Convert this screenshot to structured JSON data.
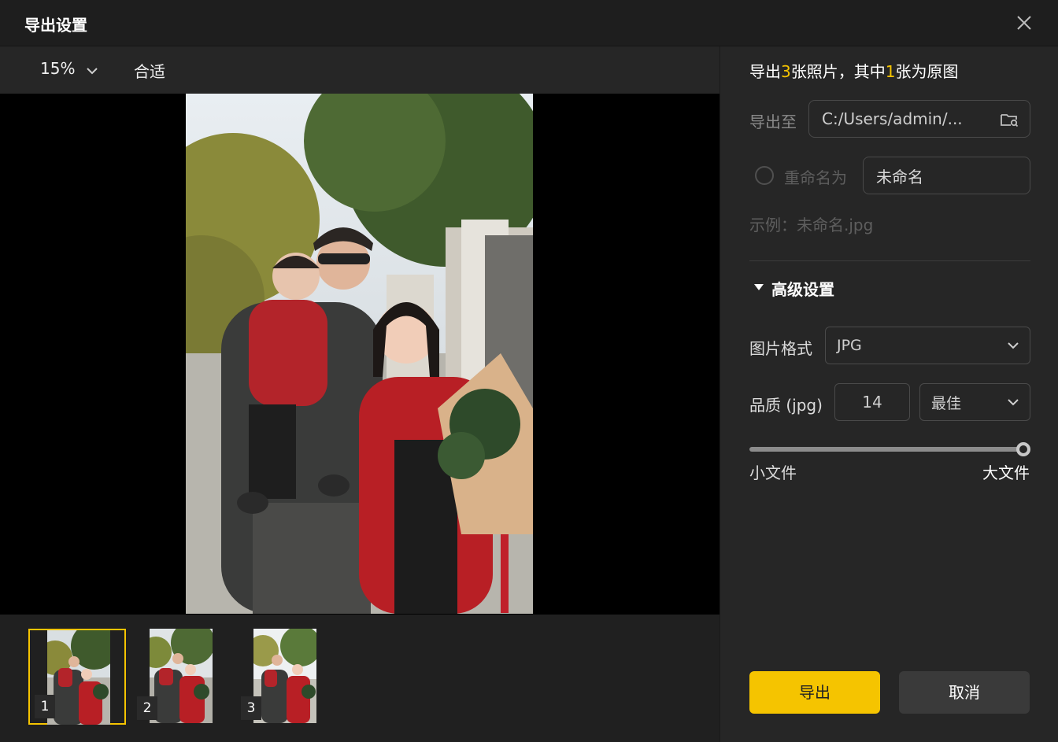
{
  "window": {
    "title": "导出设置"
  },
  "toolbar": {
    "zoom_value": "15%",
    "fit_label": "合适"
  },
  "filmstrip": {
    "items": [
      {
        "number": "1"
      },
      {
        "number": "2"
      },
      {
        "number": "3"
      }
    ]
  },
  "summary": {
    "prefix": "导出",
    "total": "3",
    "mid": "张照片，其中",
    "original": "1",
    "suffix": "张为原图"
  },
  "export_to": {
    "label": "导出至",
    "path": "C:/Users/admin/..."
  },
  "rename": {
    "label": "重命名为",
    "value": "未命名",
    "example": "示例：未命名.jpg"
  },
  "advanced": {
    "title": "高级设置",
    "format_label": "图片格式",
    "format_value": "JPG",
    "quality_label": "品质 (jpg)",
    "quality_value": "14",
    "quality_preset": "最佳",
    "slider_level": 1.0,
    "small_label": "小文件",
    "large_label": "大文件"
  },
  "buttons": {
    "export": "导出",
    "cancel": "取消"
  },
  "colors": {
    "accent": "#f5c400",
    "background": "#262626"
  }
}
